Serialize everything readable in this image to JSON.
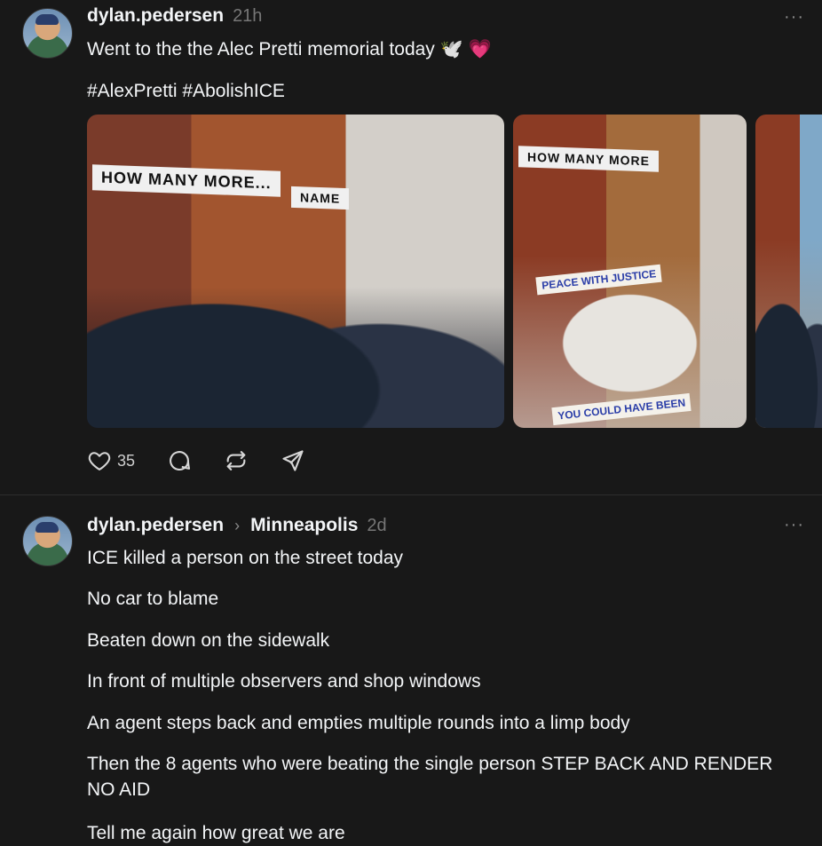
{
  "posts": [
    {
      "username": "dylan.pedersen",
      "time": "21h",
      "more": "···",
      "text_line1": "Went to the the Alec Pretti memorial today 🕊️",
      "heart_emoji": "💗",
      "hashtags": "#AlexPretti #AbolishICE",
      "photos": {
        "banner_1a": "HOW MANY MORE...",
        "banner_1b": "NAME",
        "banner_2": "HOW MANY MORE",
        "sign_2a": "PEACE WITH JUSTICE",
        "sign_2b": "YOU COULD HAVE BEEN"
      },
      "likes": "35"
    },
    {
      "username": "dylan.pedersen",
      "community": "Minneapolis",
      "chevron": "›",
      "time": "2d",
      "more": "···",
      "lines": [
        "ICE killed a person on the street today",
        "No car to blame",
        "Beaten down on the sidewalk",
        "In front of multiple observers and shop windows",
        "An agent steps back and empties multiple rounds into a limp body",
        "Then the 8 agents who were beating the single person STEP BACK AND RENDER NO AID",
        "Tell me again how great we are"
      ]
    }
  ],
  "icons": [
    "heart-icon",
    "comment-icon",
    "repost-icon",
    "share-icon",
    "more-icon"
  ],
  "colors": {
    "background": "#181818",
    "text": "#f3f5f7",
    "muted": "#777777",
    "heart_emoji": "#ec3f73"
  }
}
